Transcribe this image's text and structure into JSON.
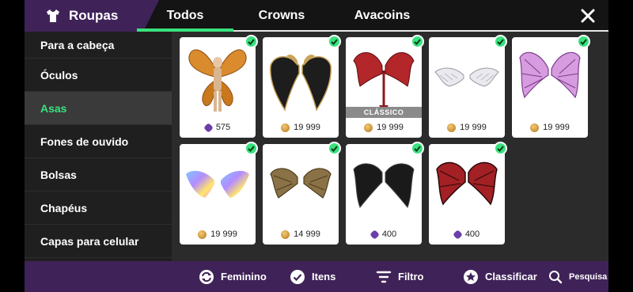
{
  "header": {
    "brand_title": "Roupas",
    "brand_icon": "shirt-icon",
    "tabs": [
      {
        "label": "Todos",
        "active": true
      },
      {
        "label": "Crowns",
        "active": false
      },
      {
        "label": "Avacoins",
        "active": false
      }
    ],
    "close_icon": "close-icon"
  },
  "sidebar": {
    "items": [
      {
        "label": "Para a cabeça",
        "active": false
      },
      {
        "label": "Óculos",
        "active": false
      },
      {
        "label": "Asas",
        "active": true
      },
      {
        "label": "Fones de ouvido",
        "active": false
      },
      {
        "label": "Bolsas",
        "active": false
      },
      {
        "label": "Chapéus",
        "active": false
      },
      {
        "label": "Capas para celular",
        "active": false
      }
    ]
  },
  "items": [
    {
      "name": "orange-fairy-wings",
      "price": "575",
      "currency": "crowns",
      "owned": true
    },
    {
      "name": "black-gold-wings",
      "price": "19 999",
      "currency": "avacoins",
      "owned": true
    },
    {
      "name": "red-devil-wings",
      "price": "19 999",
      "currency": "avacoins",
      "owned": true,
      "banner": "CLÁSSICO"
    },
    {
      "name": "white-angel-wings",
      "price": "19 999",
      "currency": "avacoins",
      "owned": true
    },
    {
      "name": "pink-dragon-wings",
      "price": "19 999",
      "currency": "avacoins",
      "owned": true
    },
    {
      "name": "rainbow-wings",
      "price": "19 999",
      "currency": "avacoins",
      "owned": true
    },
    {
      "name": "bronze-bat-wings",
      "price": "14 999",
      "currency": "avacoins",
      "owned": true
    },
    {
      "name": "black-bat-wings",
      "price": "400",
      "currency": "crowns",
      "owned": true
    },
    {
      "name": "dark-red-bat-wings",
      "price": "400",
      "currency": "crowns",
      "owned": true
    }
  ],
  "footer": {
    "feminino": "Feminino",
    "itens": "Itens",
    "filtro": "Filtro",
    "classificar": "Classificar",
    "pesquisa": "Pesquisa"
  },
  "colors": {
    "accent": "#38e27d",
    "brand": "#3f2358",
    "panel": "#1f1f1f",
    "background": "#2b2b2b"
  }
}
